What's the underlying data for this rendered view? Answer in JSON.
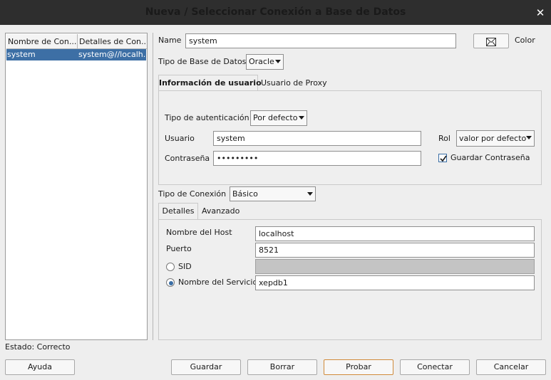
{
  "window": {
    "title": "Nueva / Seleccionar Conexión a Base de Datos",
    "close_glyph": "✕"
  },
  "connections": {
    "columns": [
      "Nombre de Con...",
      "Detalles de Con..."
    ],
    "rows": [
      {
        "name": "system",
        "details": "system@//localh..."
      }
    ]
  },
  "form": {
    "name_label": "Name",
    "name_value": "system",
    "color_label": "Color",
    "db_type_label": "Tipo de Base de Datos",
    "db_type_value": "Oracle",
    "tabs": [
      "Información de usuario",
      "Usuario de Proxy"
    ],
    "auth_type_label": "Tipo de autenticación",
    "auth_type_value": "Por defecto",
    "user_label": "Usuario",
    "user_value": "system",
    "password_label": "Contraseña",
    "password_value": "•••••••••",
    "role_label": "Rol",
    "role_value": "valor por defecto",
    "save_password_label": "Guardar Contraseña",
    "conn_type_label": "Tipo de Conexión",
    "conn_type_value": "Básico",
    "conn_tabs": [
      "Detalles",
      "Avanzado"
    ],
    "host_label": "Nombre del Host",
    "host_value": "localhost",
    "port_label": "Puerto",
    "port_value": "8521",
    "sid_label": "SID",
    "service_label": "Nombre del Servicio",
    "service_value": "xepdb1"
  },
  "status": {
    "text": "Estado: Correcto"
  },
  "buttons": {
    "help": "Ayuda",
    "save": "Guardar",
    "delete": "Borrar",
    "test": "Probar",
    "connect": "Conectar",
    "cancel": "Cancelar"
  },
  "colors": {
    "selection": "#3d6fa5",
    "titlebar": "#2e2e2e",
    "focus_border": "#d08a3a"
  },
  "icons": {
    "color_picker": "envelope-icon"
  }
}
